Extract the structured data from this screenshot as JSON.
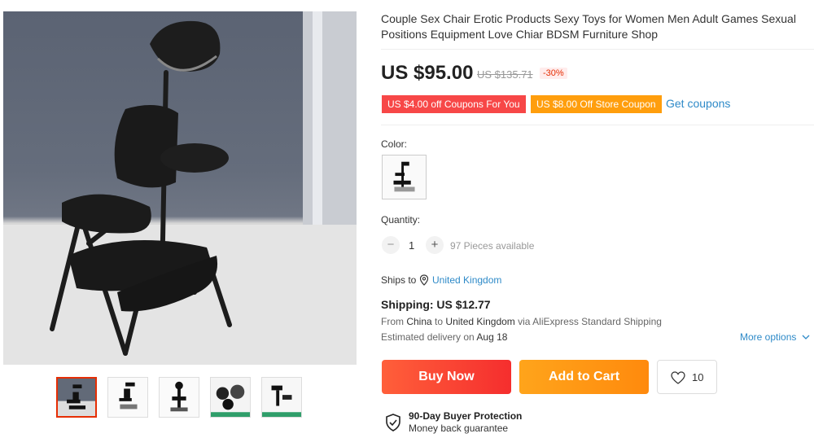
{
  "product": {
    "title": "Couple Sex Chair Erotic Products Sexy Toys for Women Men Adult Games Sexual Positions Equipment Love Chiar BDSM Furniture Shop",
    "price": "US $95.00",
    "original_price": "US $135.71",
    "discount": "-30%"
  },
  "coupons": {
    "coupon_1": "US $4.00 off Coupons For You",
    "coupon_2": "US $8.00 Off Store Coupon",
    "get_coupons": "Get coupons"
  },
  "color": {
    "label": "Color:"
  },
  "quantity": {
    "label": "Quantity:",
    "minus": "−",
    "value": "1",
    "plus": "+",
    "available": "97 Pieces available"
  },
  "shipping": {
    "ships_to_label": "Ships to",
    "ships_to_country": "United Kingdom",
    "cost": "Shipping: US $12.77",
    "route_from_label": "From",
    "route_from": "China",
    "route_to_label": "to",
    "route_to": "United Kingdom",
    "route_via": "via AliExpress Standard Shipping",
    "delivery_label": "Estimated delivery on",
    "delivery_date": "Aug 18",
    "more_options": "More options"
  },
  "actions": {
    "buy_now": "Buy Now",
    "add_to_cart": "Add to Cart",
    "wishlist_count": "10"
  },
  "protection": {
    "title": "90-Day Buyer Protection",
    "subtitle": "Money back guarantee"
  },
  "gallery": {
    "selected_index": 0,
    "thumbnail_count": 5
  }
}
